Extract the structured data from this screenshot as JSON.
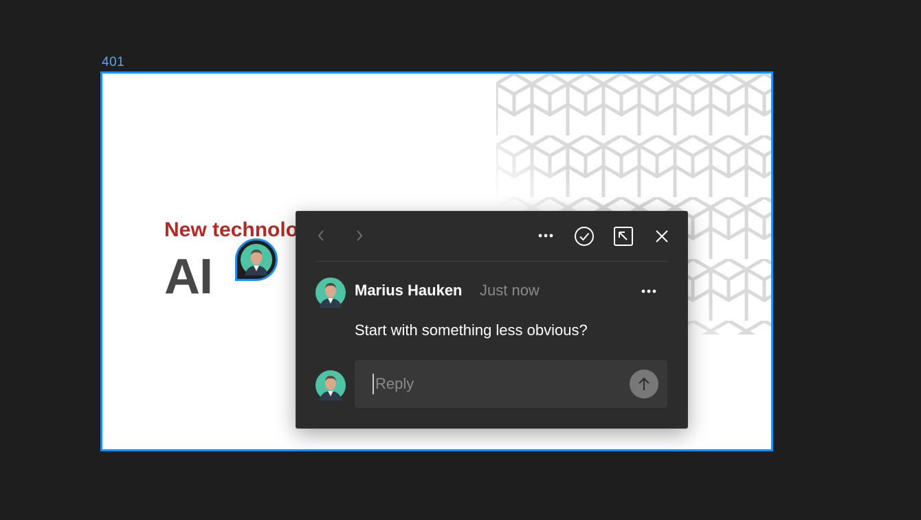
{
  "canvas": {
    "frame_label": "401"
  },
  "slide": {
    "subtitle": "New technology",
    "title": "AI"
  },
  "comment_popover": {
    "author": "Marius Hauken",
    "timestamp": "Just now",
    "comment": "Start with something less obvious?",
    "reply_placeholder": "Reply",
    "reply_value": ""
  },
  "colors": {
    "canvas_bg": "#1e1e1e",
    "selection_blue": "#1e8ef0",
    "subtitle_red": "#b22a25",
    "title_gray": "#474747",
    "popover_bg": "#2c2c2c",
    "avatar_teal": "#4ec3a6"
  },
  "icons": {
    "prev": "chevron-left-icon",
    "next": "chevron-right-icon",
    "more": "more-horizontal-icon",
    "resolve": "check-circle-icon",
    "open": "arrow-up-left-box-icon",
    "close": "close-icon",
    "send": "arrow-up-icon"
  }
}
